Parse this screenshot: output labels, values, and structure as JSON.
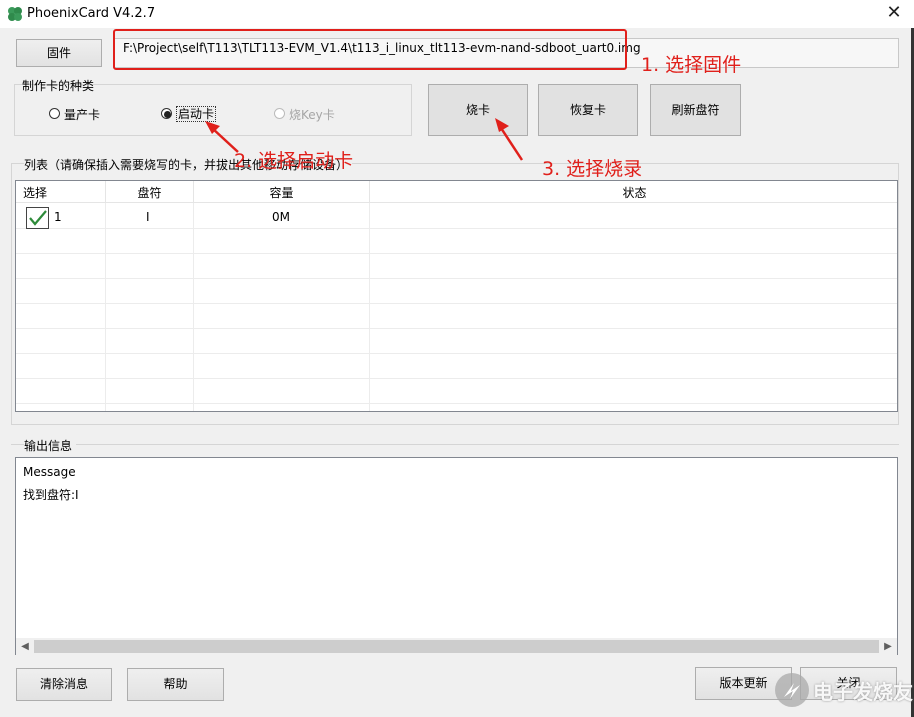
{
  "window": {
    "title": "PhoenixCard V4.2.7",
    "close_glyph": "✕",
    "icon": "phoenix-app-icon"
  },
  "firmware": {
    "button_label": "固件",
    "path": "F:\\Project\\self\\T113\\TLT113-EVM_V1.4\\t113_i_linux_tlt113-evm-nand-sdboot_uart0.img"
  },
  "card_type": {
    "group_label": "制作卡的种类",
    "options": [
      {
        "label": "量产卡",
        "selected": false,
        "enabled": true
      },
      {
        "label": "启动卡",
        "selected": true,
        "enabled": true
      },
      {
        "label": "烧Key卡",
        "selected": false,
        "enabled": false
      }
    ]
  },
  "actions": {
    "burn": "烧卡",
    "restore": "恢复卡",
    "refresh": "刷新盘符"
  },
  "device_list": {
    "label": "列表（请确保插入需要烧写的卡，并拔出其他移动存储设备）",
    "columns": [
      "选择",
      "盘符",
      "容量",
      "状态"
    ],
    "rows": [
      {
        "checked": true,
        "index": "1",
        "drive": "I",
        "capacity": "0M",
        "status": ""
      }
    ]
  },
  "output": {
    "label": "输出信息",
    "lines": [
      "Message",
      "找到盘符:I"
    ]
  },
  "bottom_buttons": {
    "clear": "清除消息",
    "help": "帮助",
    "update": "版本更新",
    "close": "关闭"
  },
  "annotations": {
    "step1": "1. 选择固件",
    "step2": "2. 选择启动卡",
    "step3": "3. 选择烧录",
    "color": "#e0201b"
  },
  "watermark": {
    "text": "电子发烧友"
  }
}
